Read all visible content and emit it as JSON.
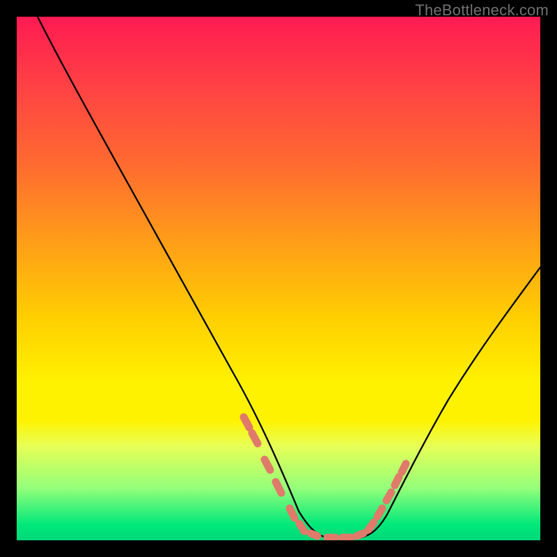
{
  "watermark": "TheBottleneck.com",
  "chart_data": {
    "type": "line",
    "title": "",
    "xlabel": "",
    "ylabel": "",
    "xlim": [
      0,
      100
    ],
    "ylim": [
      0,
      100
    ],
    "grid": false,
    "legend": false,
    "description": "V-shaped bottleneck curve: left branch descends steeply, flat minimum near x≈55–65, right branch rises",
    "series": [
      {
        "name": "curve",
        "x": [
          4,
          8,
          12,
          16,
          20,
          24,
          28,
          32,
          36,
          40,
          44,
          48,
          50,
          52,
          54,
          56,
          58,
          60,
          62,
          64,
          66,
          68,
          72,
          76,
          80,
          84,
          88,
          92,
          96,
          100
        ],
        "y": [
          100,
          93,
          86,
          79,
          71,
          64,
          56,
          49,
          41,
          33,
          26,
          18,
          14,
          10,
          6,
          3,
          1.5,
          1,
          1,
          1,
          1.5,
          3,
          8,
          14,
          20,
          27,
          34,
          41,
          47,
          53
        ]
      }
    ],
    "markers": {
      "name": "salmon-dashes",
      "color": "#e07a6a",
      "x": [
        44,
        45.5,
        48,
        50,
        53,
        55,
        57,
        60,
        63,
        65,
        67,
        69,
        71,
        72.5,
        73.5
      ],
      "y": [
        23,
        20,
        14,
        10,
        4.5,
        2.5,
        1.3,
        1,
        1,
        1.2,
        1.8,
        3.5,
        7,
        10,
        12.5
      ]
    },
    "background_gradient": [
      {
        "stop": 0.0,
        "color": "#ff1a52"
      },
      {
        "stop": 0.28,
        "color": "#ff6a30"
      },
      {
        "stop": 0.58,
        "color": "#ffd000"
      },
      {
        "stop": 0.77,
        "color": "#fff200"
      },
      {
        "stop": 0.9,
        "color": "#95ff7a"
      },
      {
        "stop": 1.0,
        "color": "#00d87a"
      }
    ]
  }
}
